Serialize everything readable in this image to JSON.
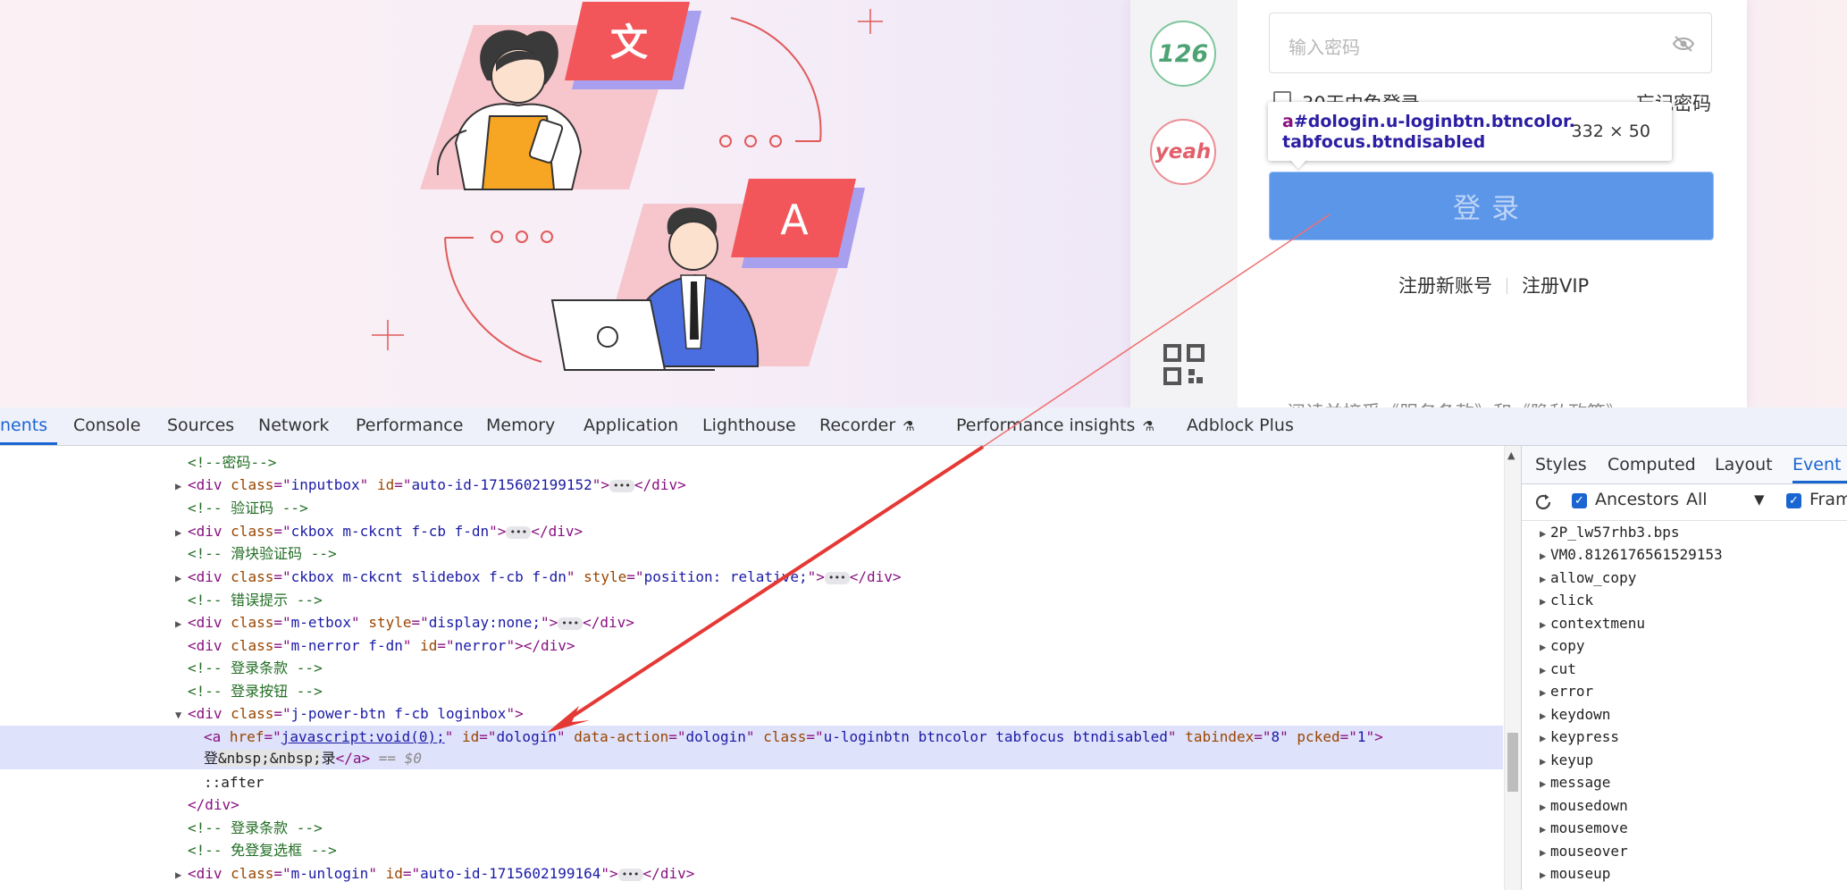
{
  "login": {
    "logo_126": "126",
    "logo_yeah": "yeah",
    "password_placeholder": "输入密码",
    "remember_label": "30天内免登录",
    "forgot_label": "忘记密码",
    "login_button": "登录",
    "register_account": "注册新账号",
    "register_vip": "注册VIP",
    "terms_partial": "阅读并接受《服务条款》和《隐私政策》"
  },
  "tooltip": {
    "tag": "a",
    "selector": "#dologin.u-loginbtn.btncolor.tabfocus.btndisabled",
    "size": "332 × 50"
  },
  "illustration": {
    "card_left_char": "文",
    "card_right_char": "A"
  },
  "devtools": {
    "tabs": [
      "nents",
      "Console",
      "Sources",
      "Network",
      "Performance",
      "Memory",
      "Application",
      "Lighthouse",
      "Recorder",
      "Performance insights",
      "Adblock Plus"
    ],
    "active_tab": "nents",
    "side_tabs": [
      "Styles",
      "Computed",
      "Layout",
      "Event L"
    ],
    "side_active_tab": "Event L",
    "ancestors_label": "Ancestors",
    "filter_value": "All",
    "framework_label": "Fram",
    "events": [
      "2P_lw57rhb3.bps",
      "VM0.8126176561529153",
      "allow_copy",
      "click",
      "contextmenu",
      "copy",
      "cut",
      "error",
      "keydown",
      "keypress",
      "keyup",
      "message",
      "mousedown",
      "mousemove",
      "mouseover",
      "mouseup"
    ],
    "code": {
      "c_password": "<!--密码-->",
      "inputbox_class": "inputbox",
      "inputbox_id": "auto-id-1715602199152",
      "c_captcha": "<!-- 验证码 -->",
      "ckbox_class": "ckbox m-ckcnt f-cb f-dn",
      "c_slider": "<!-- 滑块验证码 -->",
      "slide_class": "ckbox m-ckcnt slidebox f-cb f-dn",
      "slide_style": "position: relative;",
      "c_error": "<!-- 错误提示 -->",
      "etbox_class": "m-etbox",
      "etbox_style": "display:none;",
      "nerror_class": "m-nerror f-dn",
      "nerror_id": "nerror",
      "c_terms": "<!-- 登录条款 -->",
      "c_button": "<!-- 登录按钮 -->",
      "power_class": "j-power-btn f-cb loginbox",
      "a_href": "javascript:void(0);",
      "a_id": "dologin",
      "a_action": "dologin",
      "a_class": "u-loginbtn btncolor tabfocus btndisabled",
      "a_tabindex": "8",
      "a_pcked": "1",
      "a_text_1": "登",
      "a_nbsp": "&nbsp;&nbsp;",
      "a_text_2": "录",
      "dollar0": "== $0",
      "after": "::after",
      "c_terms2": "<!-- 登录条款 -->",
      "c_autologin": "<!-- 免登复选框 -->",
      "unlogin_class": "m-unlogin",
      "unlogin_id": "auto-id-1715602199164"
    }
  },
  "colors": {
    "login_button": "#5c96e9",
    "annotation_arrow": "#e53935",
    "devtools_accent": "#1a66d1"
  }
}
